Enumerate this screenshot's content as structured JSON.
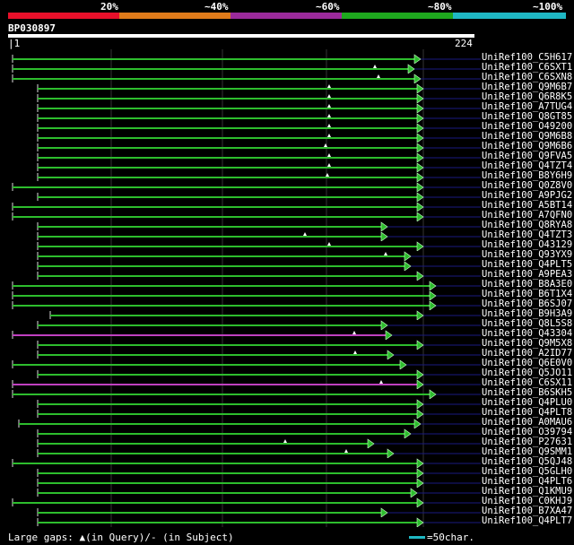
{
  "header": {
    "percent_labels": [
      "20%",
      "~40%",
      "~60%",
      "~80%",
      "~100%"
    ],
    "band_colors": [
      "#e8102a",
      "#e07b1a",
      "#9b2a9b",
      "#1ea81e",
      "#1fb8c4"
    ]
  },
  "query": {
    "id": "BP030897",
    "start_label": "1",
    "end_label": "224"
  },
  "colors": {
    "hit_line": "#2dbd2d",
    "hit_highlight": "#c040c0",
    "query_range_line": "#1a1a80",
    "gap_marker": "#ffffff",
    "arrow_fill": "#2dbd2d"
  },
  "rows": [
    {
      "label": "UniRef100_C5H617",
      "color": "green"
    },
    {
      "label": "UniRef100_C6SXT1",
      "color": "green"
    },
    {
      "label": "UniRef100_C6SXN8",
      "color": "green"
    },
    {
      "label": "UniRef100_Q9M6B7",
      "color": "green"
    },
    {
      "label": "UniRef100_Q6R8K5",
      "color": "green"
    },
    {
      "label": "UniRef100_A7TUG4",
      "color": "green"
    },
    {
      "label": "UniRef100_Q8GT85",
      "color": "green"
    },
    {
      "label": "UniRef100_O49200",
      "color": "green"
    },
    {
      "label": "UniRef100_Q9M6B8",
      "color": "green"
    },
    {
      "label": "UniRef100_Q9M6B6",
      "color": "green"
    },
    {
      "label": "UniRef100_Q9FVA5",
      "color": "green"
    },
    {
      "label": "UniRef100_Q4TZT4",
      "color": "green"
    },
    {
      "label": "UniRef100_B8Y6H9",
      "color": "green"
    },
    {
      "label": "UniRef100_Q0Z8V0",
      "color": "green"
    },
    {
      "label": "UniRef100_A9PJG2",
      "color": "green"
    },
    {
      "label": "UniRef100_A5BT14",
      "color": "green"
    },
    {
      "label": "UniRef100_A7QFN0",
      "color": "green"
    },
    {
      "label": "UniRef100_Q8RYA8",
      "color": "green"
    },
    {
      "label": "UniRef100_Q4TZT3",
      "color": "green"
    },
    {
      "label": "UniRef100_O43129",
      "color": "green"
    },
    {
      "label": "UniRef100_Q93YX9",
      "color": "green"
    },
    {
      "label": "UniRef100_Q4PLT5",
      "color": "green"
    },
    {
      "label": "UniRef100_A9PEA3",
      "color": "green"
    },
    {
      "label": "UniRef100_B8A3E0",
      "color": "green"
    },
    {
      "label": "UniRef100_B6T1X4",
      "color": "green"
    },
    {
      "label": "UniRef100_B6SJ07",
      "color": "green"
    },
    {
      "label": "UniRef100_B9H3A9",
      "color": "green"
    },
    {
      "label": "UniRef100_Q8L5S8",
      "color": "green"
    },
    {
      "label": "UniRef100_Q43304",
      "color": "purple"
    },
    {
      "label": "UniRef100_Q9M5X8",
      "color": "green"
    },
    {
      "label": "UniRef100_A2ID77",
      "color": "green"
    },
    {
      "label": "UniRef100_Q6E0V0",
      "color": "green"
    },
    {
      "label": "UniRef100_Q5JO11",
      "color": "green"
    },
    {
      "label": "UniRef100_C6SX11",
      "color": "purple"
    },
    {
      "label": "UniRef100_B6SKH5",
      "color": "green"
    },
    {
      "label": "UniRef100_Q4PLU0",
      "color": "green"
    },
    {
      "label": "UniRef100_Q4PLT8",
      "color": "green"
    },
    {
      "label": "UniRef100_A0MAU6",
      "color": "green"
    },
    {
      "label": "UniRef100_O39794",
      "color": "green"
    },
    {
      "label": "UniRef100_P27631",
      "color": "green"
    },
    {
      "label": "UniRef100_Q9SMM1",
      "color": "green"
    },
    {
      "label": "UniRef100_Q5QJ48",
      "color": "green"
    },
    {
      "label": "UniRef100_Q5GLH0",
      "color": "green"
    },
    {
      "label": "UniRef100_Q4PLT6",
      "color": "green"
    },
    {
      "label": "UniRef100_Q1KMU9",
      "color": "green"
    },
    {
      "label": "UniRef100_C0KHJ9",
      "color": "green"
    },
    {
      "label": "UniRef100_B7XA47",
      "color": "green"
    },
    {
      "label": "UniRef100_Q4PLT7",
      "color": "green"
    }
  ],
  "legend": {
    "text": "Large gaps: ▲(in Query)/- (in Subject)",
    "scale_label": "=50char."
  }
}
